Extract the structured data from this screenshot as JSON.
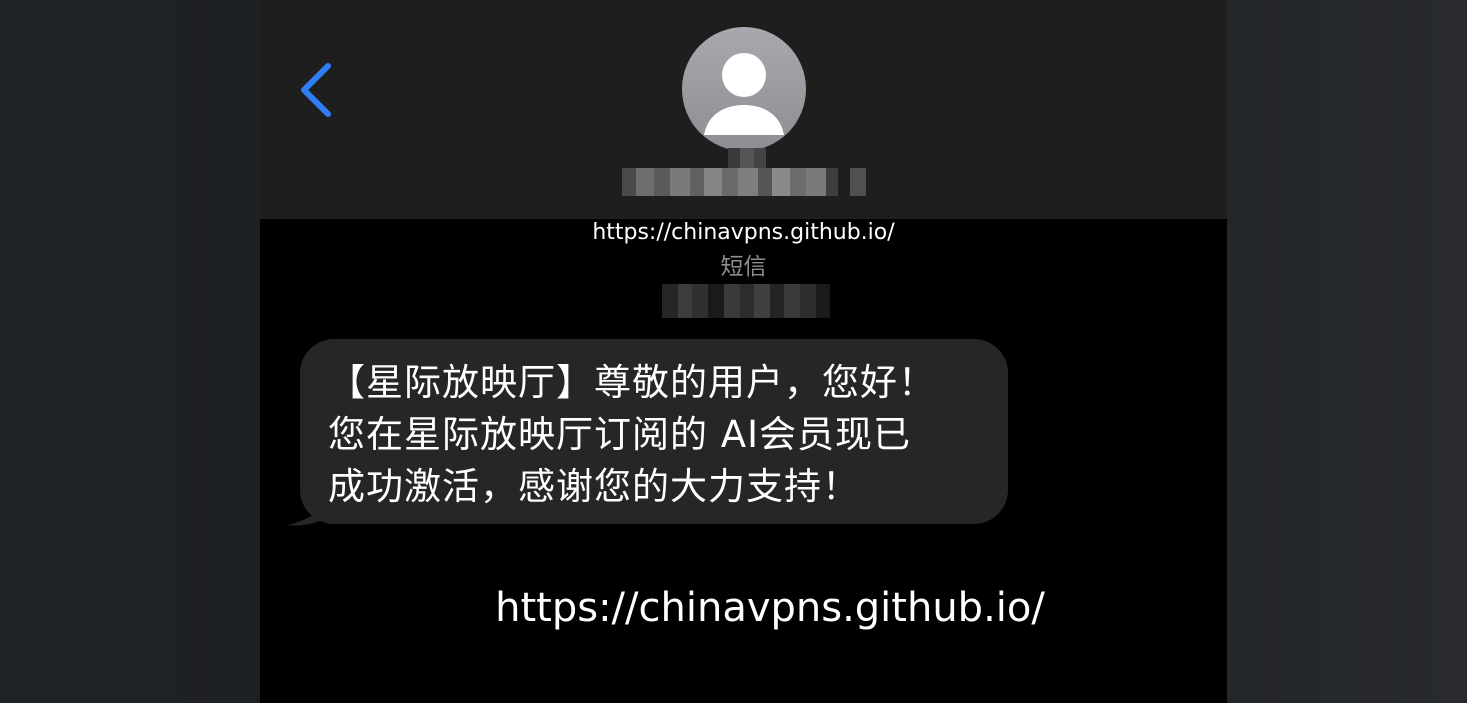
{
  "header": {
    "back_icon": "chevron-left-icon",
    "accent_color": "#2f7ef6",
    "avatar_icon": "person-silhouette-icon",
    "contact_name": "(redacted)"
  },
  "overlay": {
    "url_top": "https://chinavpns.github.io/",
    "url_bottom": "https://chinavpns.github.io/"
  },
  "conversation": {
    "service_label": "短信",
    "timestamp": "(redacted)",
    "messages": [
      {
        "direction": "incoming",
        "text": "【星际放映厅】尊敬的用户，您好！\n您在星际放映厅订阅的 AI会员现已\n成功激活，感谢您的大力支持！"
      }
    ]
  }
}
